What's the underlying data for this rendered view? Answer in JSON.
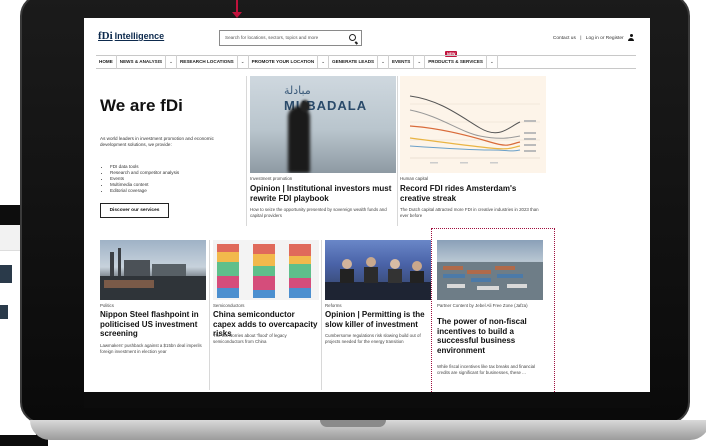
{
  "header": {
    "logo_mark": "fDi",
    "logo_text": "Intelligence",
    "search_placeholder": "Search for locations, sectors, topics and more",
    "contact_link": "Contact us",
    "login_link": "Log in or Register"
  },
  "nav": {
    "items": [
      {
        "label": "HOME",
        "has_dropdown": false
      },
      {
        "label": "NEWS & ANALYSIS",
        "has_dropdown": true
      },
      {
        "label": "RESEARCH LOCATIONS",
        "has_dropdown": true
      },
      {
        "label": "PROMOTE YOUR LOCATION",
        "has_dropdown": true
      },
      {
        "label": "GENERATE LEADS",
        "has_dropdown": true
      },
      {
        "label": "EVENTS",
        "has_dropdown": true
      },
      {
        "label": "PRODUCTS & SERVICES",
        "has_dropdown": true
      }
    ],
    "new_badge": "NEW"
  },
  "hero": {
    "title": "We are fDi",
    "description": "As world leaders in investment promotion and economic development solutions, we provide:",
    "list": [
      "FDI data tools",
      "Research and competitor analysis",
      "Events",
      "Multimedia content",
      "Editorial coverage"
    ],
    "cta": "Discover our services"
  },
  "featured": [
    {
      "image_text_arabic": "مبادلة",
      "image_text": "MUBADALA",
      "tag": "Investment promotion",
      "title": "Opinion | Institutional investors must rewrite FDI playbook",
      "desc": "How to seize the opportunity presented by sovereign wealth funds and capital providers"
    },
    {
      "tag": "Human capital",
      "title": "Record FDI rides Amsterdam's creative streak",
      "desc": "The Dutch capital attracted more FDI in creative industries in 2023 than ever before"
    }
  ],
  "articles": [
    {
      "tag": "Politics",
      "title": "Nippon Steel flashpoint in politicised US investment screening",
      "desc": "Lawmakers' pushback against a $15bn deal imperils foreign investment in election year"
    },
    {
      "tag": "Semiconductors",
      "title": "China semiconductor capex adds to overcapacity risks",
      "desc": "The US worries about 'flood' of legacy semiconductors from China"
    },
    {
      "tag": "Reforms",
      "title": "Opinion | Permitting is the slow killer of investment",
      "desc": "Cumbersome regulations risk slowing build out of projects needed for the energy transition"
    },
    {
      "tag": "Partner Content by Jebel Ali Free Zone (Jafza)",
      "title": "The power of non-fiscal incentives to build a successful business environment",
      "desc": "While fiscal incentives like tax breaks and financial credits are significant for businesses, these ..."
    }
  ],
  "colors": {
    "accent": "#c0123c",
    "brand_navy": "#0d2a4d",
    "chart_bg": "#fdf4e9"
  }
}
